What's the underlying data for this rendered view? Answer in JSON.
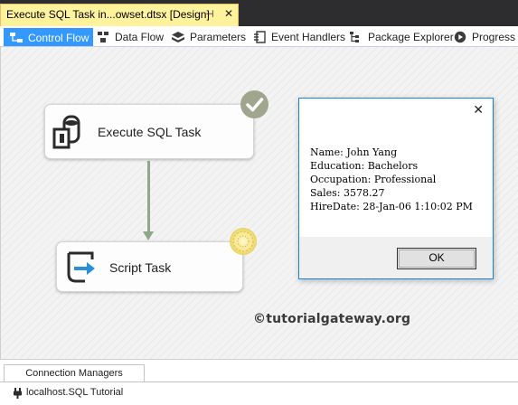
{
  "document_tab": {
    "title": "Execute SQL Task in...owset.dtsx [Design]",
    "pin_glyph": "⊣",
    "close_glyph": "✕"
  },
  "designer_tabs": [
    {
      "label": "Control Flow",
      "icon": "control-flow-icon",
      "active": true
    },
    {
      "label": "Data Flow",
      "icon": "data-flow-icon",
      "active": false
    },
    {
      "label": "Parameters",
      "icon": "parameters-icon",
      "active": false
    },
    {
      "label": "Event Handlers",
      "icon": "event-handlers-icon",
      "active": false
    },
    {
      "label": "Package Explorer",
      "icon": "package-explorer-icon",
      "active": false
    },
    {
      "label": "Progress",
      "icon": "progress-icon",
      "active": false
    }
  ],
  "tasks": {
    "execute_sql": {
      "label": "Execute SQL Task",
      "status": "success"
    },
    "script": {
      "label": "Script Task",
      "status": "running"
    }
  },
  "message_box": {
    "lines": [
      "Name: John Yang",
      "Education: Bachelors",
      "Occupation: Professional",
      "Sales: 3578.27",
      "HireDate: 28-Jan-06 1:10:02 PM"
    ],
    "ok_label": "OK",
    "close_glyph": "✕"
  },
  "watermark": "©tutorialgateway.org",
  "connection_managers": {
    "tab_label": "Connection Managers",
    "items": [
      {
        "label": "localhost.SQL Tutorial",
        "icon": "connection-plug-icon"
      }
    ]
  },
  "colors": {
    "document_tab": "#fff29d",
    "active_designer_tab": "#3399ff",
    "precedence_constraint": "#8da987",
    "message_box_border": "#1883d7"
  }
}
